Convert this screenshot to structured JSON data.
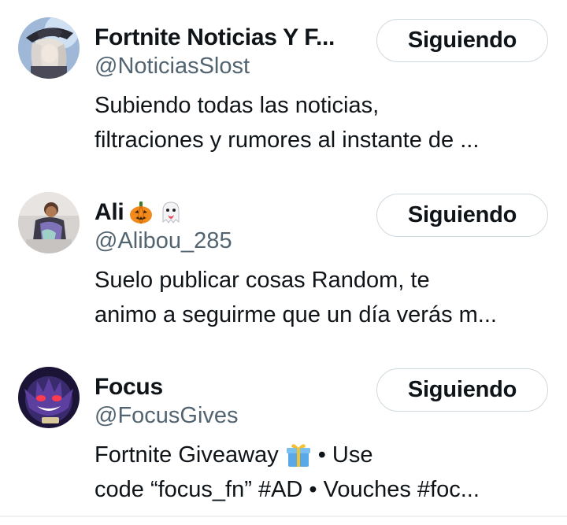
{
  "accounts": [
    {
      "name": "Fortnite Noticias Y F...",
      "handle": "@NoticiasSlost",
      "follow_label": "Siguiendo",
      "bio_line1": "Subiendo todas las noticias,",
      "bio_line2": "filtraciones y rumores al instante de ..."
    },
    {
      "name": "Ali",
      "name_emojis": [
        "pumpkin-icon",
        "ghost-icon"
      ],
      "handle": "@Alibou_285",
      "follow_label": "Siguiendo",
      "bio_line1": "Suelo publicar cosas Random, te",
      "bio_line2": "animo a seguirme que un día verás m..."
    },
    {
      "name": "Focus",
      "handle": "@FocusGives",
      "follow_label": "Siguiendo",
      "bio_line1_a": "Fortnite Giveaway",
      "bio_line1_emoji": "gift-icon",
      "bio_line1_b": "• Use",
      "bio_line2": "code “focus_fn” #AD • Vouches #foc..."
    }
  ],
  "colors": {
    "text_primary": "#0f1419",
    "text_secondary": "#536471",
    "button_border": "#cfd9de",
    "divider": "#eff3f4"
  }
}
